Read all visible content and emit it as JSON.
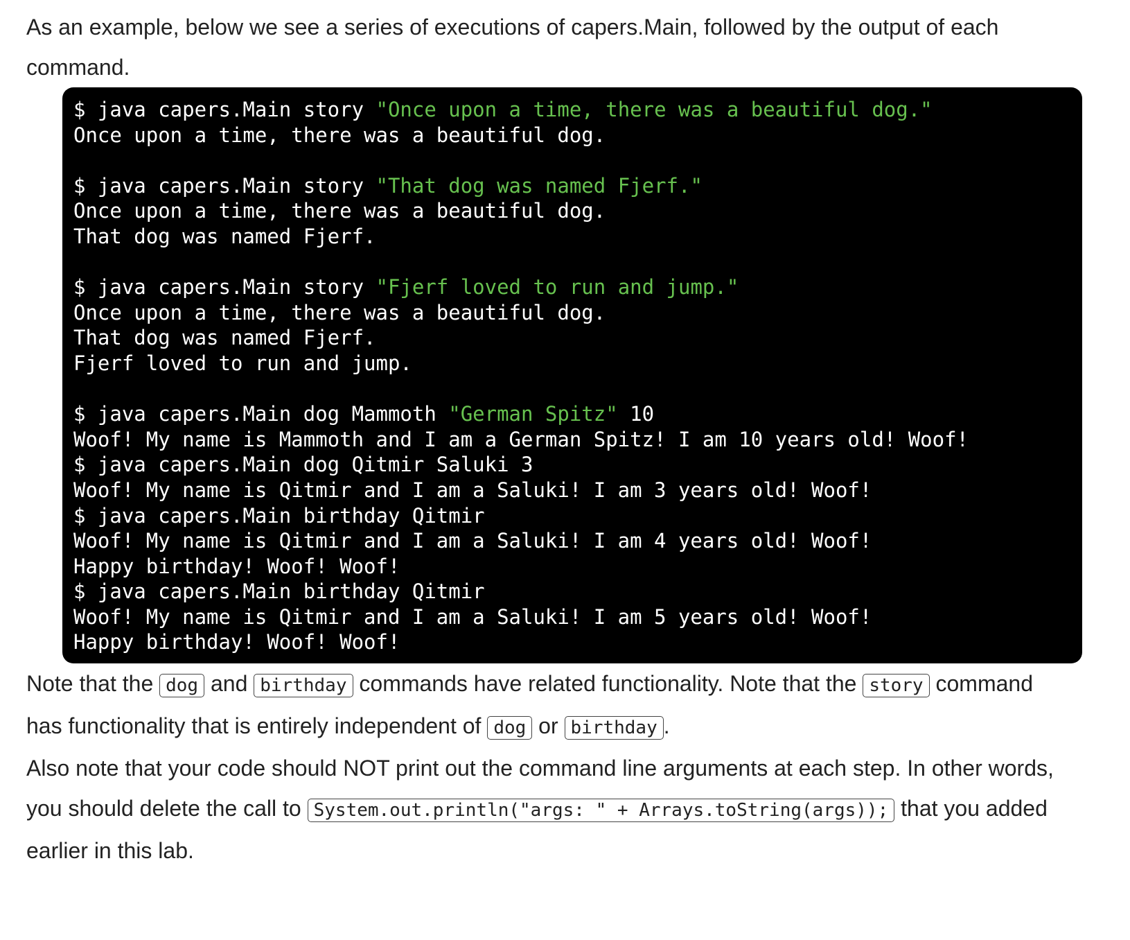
{
  "intro": {
    "line1": "As an example, below we see a series of executions of capers.Main, followed by the output of each",
    "line2": "command."
  },
  "terminal": {
    "lines": [
      {
        "cmd": "$ java capers.Main story ",
        "str": "\"Once upon a time, there was a beautiful dog.\"",
        "rest": ""
      },
      {
        "out": "Once upon a time, there was a beautiful dog."
      },
      {
        "blank": true
      },
      {
        "cmd": "$ java capers.Main story ",
        "str": "\"That dog was named Fjerf.\"",
        "rest": ""
      },
      {
        "out": "Once upon a time, there was a beautiful dog."
      },
      {
        "out": "That dog was named Fjerf."
      },
      {
        "blank": true
      },
      {
        "cmd": "$ java capers.Main story ",
        "str": "\"Fjerf loved to run and jump.\"",
        "rest": ""
      },
      {
        "out": "Once upon a time, there was a beautiful dog."
      },
      {
        "out": "That dog was named Fjerf."
      },
      {
        "out": "Fjerf loved to run and jump."
      },
      {
        "blank": true
      },
      {
        "cmd": "$ java capers.Main dog Mammoth ",
        "str": "\"German Spitz\"",
        "rest": " 10"
      },
      {
        "out": "Woof! My name is Mammoth and I am a German Spitz! I am 10 years old! Woof!"
      },
      {
        "out": "$ java capers.Main dog Qitmir Saluki 3"
      },
      {
        "out": "Woof! My name is Qitmir and I am a Saluki! I am 3 years old! Woof!"
      },
      {
        "out": "$ java capers.Main birthday Qitmir"
      },
      {
        "out": "Woof! My name is Qitmir and I am a Saluki! I am 4 years old! Woof!"
      },
      {
        "out": "Happy birthday! Woof! Woof!"
      },
      {
        "out": "$ java capers.Main birthday Qitmir"
      },
      {
        "out": "Woof! My name is Qitmir and I am a Saluki! I am 5 years old! Woof!"
      },
      {
        "out": "Happy birthday! Woof! Woof!"
      }
    ]
  },
  "note1": {
    "t1": "Note that the ",
    "c1": "dog",
    "t2": " and ",
    "c2": "birthday",
    "t3": " commands have related functionality. Note that the ",
    "c3": "story",
    "t4": " command",
    "t5": "has functionality that is entirely independent of ",
    "c4": "dog",
    "t6": " or ",
    "c5": "birthday",
    "t7": "."
  },
  "note2": {
    "t1": "Also note that your code should NOT print out the command line arguments at each step. In other words,",
    "t2": "you should delete the call to ",
    "c1": "System.out.println(\"args: \" + Arrays.toString(args));",
    "t3": " that you added",
    "t4": "earlier in this lab."
  }
}
